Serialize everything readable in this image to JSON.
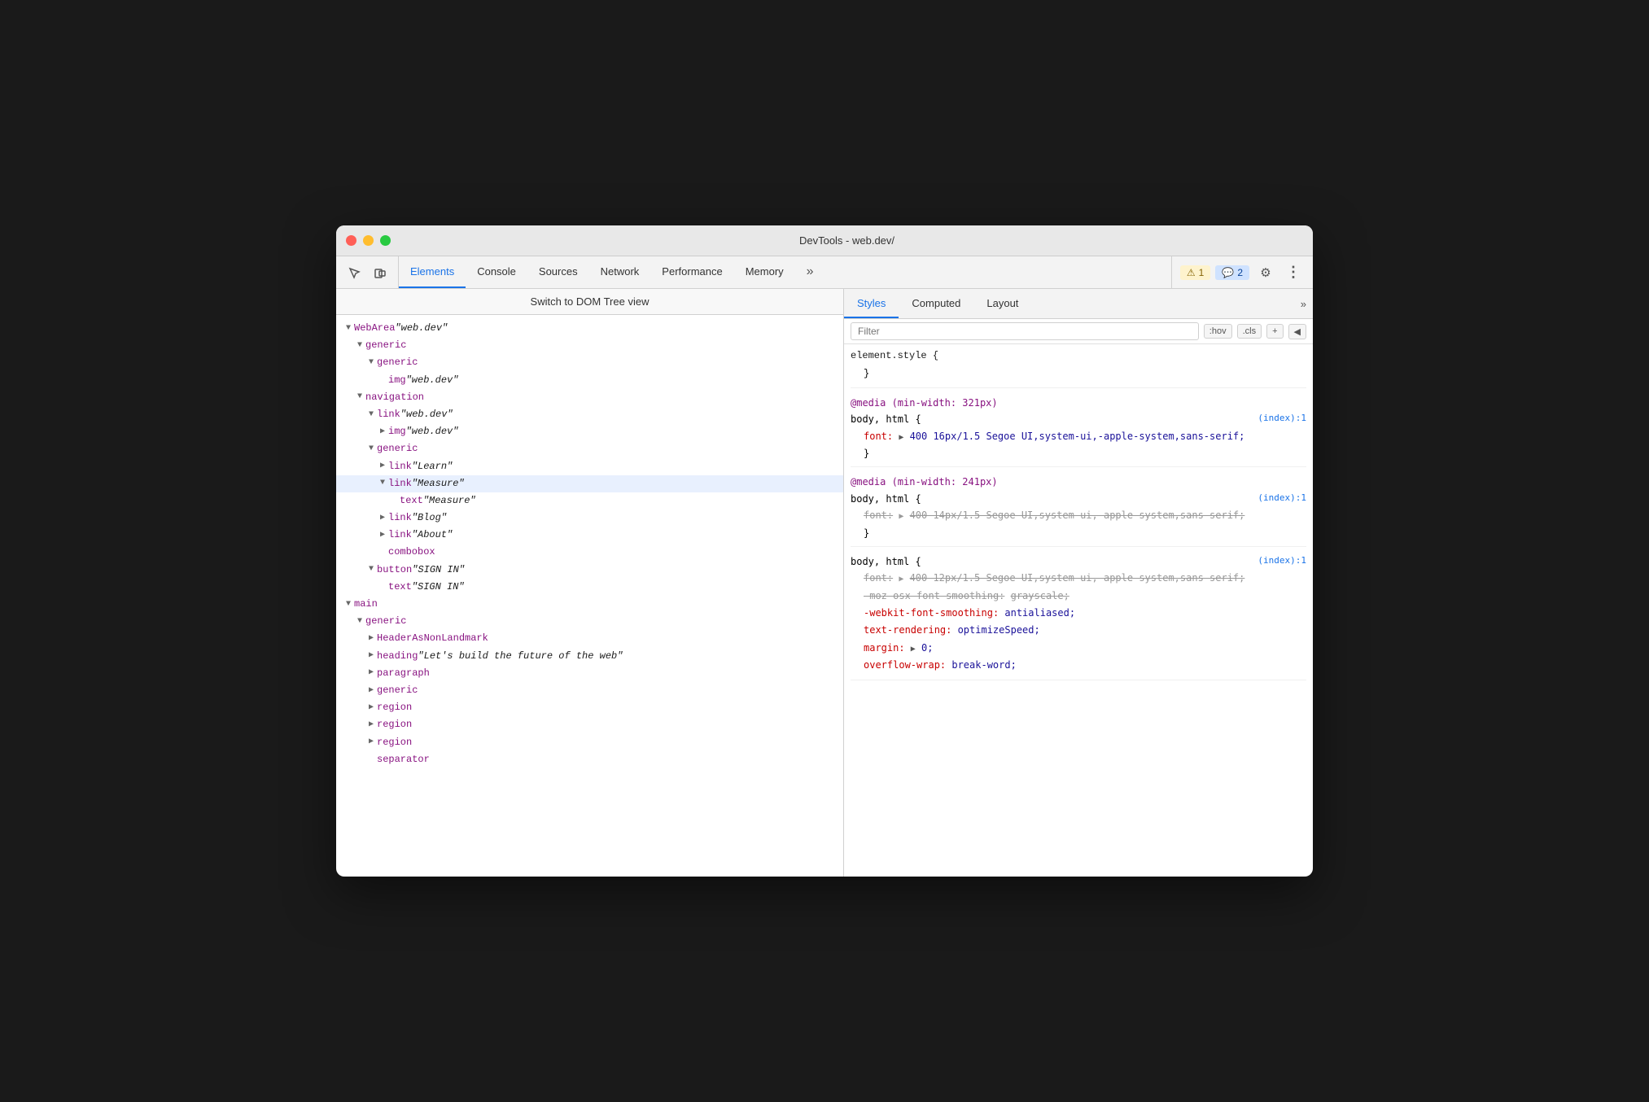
{
  "window": {
    "title": "DevTools - web.dev/"
  },
  "titlebar": {
    "close_label": "",
    "min_label": "",
    "max_label": ""
  },
  "toolbar": {
    "tabs": [
      {
        "id": "elements",
        "label": "Elements",
        "active": true
      },
      {
        "id": "console",
        "label": "Console",
        "active": false
      },
      {
        "id": "sources",
        "label": "Sources",
        "active": false
      },
      {
        "id": "network",
        "label": "Network",
        "active": false
      },
      {
        "id": "performance",
        "label": "Performance",
        "active": false
      },
      {
        "id": "memory",
        "label": "Memory",
        "active": false
      }
    ],
    "more_tabs_label": "»",
    "warning_badge": "⚠ 1",
    "info_badge": "💬 2",
    "settings_icon": "⚙",
    "more_options_icon": "⋮"
  },
  "dom_panel": {
    "breadcrumb": "Switch to DOM Tree view",
    "tree": [
      {
        "id": 1,
        "indent": 0,
        "arrow": "▼",
        "content": "WebArea ",
        "italic": "web.dev",
        "quotes": true
      },
      {
        "id": 2,
        "indent": 1,
        "arrow": "▼",
        "content": "generic"
      },
      {
        "id": 3,
        "indent": 2,
        "arrow": "▼",
        "content": "generic"
      },
      {
        "id": 4,
        "indent": 3,
        "arrow": "",
        "content": "img ",
        "italic": "web.dev",
        "quotes": true
      },
      {
        "id": 5,
        "indent": 1,
        "arrow": "▼",
        "content": "navigation"
      },
      {
        "id": 6,
        "indent": 2,
        "arrow": "▼",
        "content": "link ",
        "italic": "web.dev",
        "quotes": true
      },
      {
        "id": 7,
        "indent": 3,
        "arrow": "▶",
        "content": "img ",
        "italic": "web.dev",
        "quotes": true
      },
      {
        "id": 8,
        "indent": 2,
        "arrow": "▼",
        "content": "generic"
      },
      {
        "id": 9,
        "indent": 3,
        "arrow": "▶",
        "content": "link ",
        "italic": "Learn",
        "quotes": true
      },
      {
        "id": 10,
        "indent": 3,
        "arrow": "▼",
        "content": "link ",
        "italic": "Measure",
        "quotes": true,
        "selected": true
      },
      {
        "id": 11,
        "indent": 4,
        "arrow": "",
        "content": "text ",
        "italic": "Measure",
        "quotes": true
      },
      {
        "id": 12,
        "indent": 3,
        "arrow": "▶",
        "content": "link ",
        "italic": "Blog",
        "quotes": true
      },
      {
        "id": 13,
        "indent": 3,
        "arrow": "▶",
        "content": "link ",
        "italic": "About",
        "quotes": true
      },
      {
        "id": 14,
        "indent": 3,
        "arrow": "",
        "content": "combobox"
      },
      {
        "id": 15,
        "indent": 2,
        "arrow": "▼",
        "content": "button ",
        "italic": "SIGN IN",
        "quotes": true
      },
      {
        "id": 16,
        "indent": 3,
        "arrow": "",
        "content": "text ",
        "italic": "SIGN IN",
        "quotes": true
      },
      {
        "id": 17,
        "indent": 0,
        "arrow": "▼",
        "content": "main"
      },
      {
        "id": 18,
        "indent": 1,
        "arrow": "▼",
        "content": "generic"
      },
      {
        "id": 19,
        "indent": 2,
        "arrow": "▶",
        "content": "HeaderAsNonLandmark"
      },
      {
        "id": 20,
        "indent": 2,
        "arrow": "▶",
        "content": "heading ",
        "italic": "Let's build the future of the web",
        "quotes": true
      },
      {
        "id": 21,
        "indent": 2,
        "arrow": "▶",
        "content": "paragraph"
      },
      {
        "id": 22,
        "indent": 2,
        "arrow": "▶",
        "content": "generic"
      },
      {
        "id": 23,
        "indent": 2,
        "arrow": "▶",
        "content": "region"
      },
      {
        "id": 24,
        "indent": 2,
        "arrow": "▶",
        "content": "region"
      },
      {
        "id": 25,
        "indent": 2,
        "arrow": "▶",
        "content": "region"
      },
      {
        "id": 26,
        "indent": 2,
        "arrow": "",
        "content": "separator"
      }
    ]
  },
  "styles_panel": {
    "tabs": [
      {
        "id": "styles",
        "label": "Styles",
        "active": true
      },
      {
        "id": "computed",
        "label": "Computed",
        "active": false
      },
      {
        "id": "layout",
        "label": "Layout",
        "active": false
      }
    ],
    "filter_placeholder": "Filter",
    "hov_btn": ":hov",
    "cls_btn": ".cls",
    "add_btn": "+",
    "toggle_btn": "◀",
    "rules": [
      {
        "id": 1,
        "selector_parts": [
          {
            "text": "element.style {",
            "type": "selector"
          }
        ],
        "source": "",
        "properties": [
          {
            "id": 1,
            "content": "}",
            "type": "close"
          }
        ]
      },
      {
        "id": 2,
        "media": "@media (min-width: 321px)",
        "selector": "body, html {",
        "source": "(index):1",
        "properties": [
          {
            "id": 1,
            "name": "font:",
            "arrow": "▶",
            "value": " 400 16px/1.5 Segoe UI,system-ui,-apple-system,sans-serif;",
            "strikethrough": false
          }
        ],
        "close": "}"
      },
      {
        "id": 3,
        "media": "@media (min-width: 241px)",
        "selector": "body, html {",
        "source": "(index):1",
        "properties": [
          {
            "id": 1,
            "name": "font:",
            "arrow": "▶",
            "value": " 400 14px/1.5 Segoe UI,system-ui,-apple-system,sans-serif;",
            "strikethrough": true
          }
        ],
        "close": "}"
      },
      {
        "id": 4,
        "selector": "body, html {",
        "source": "(index):1",
        "properties": [
          {
            "id": 1,
            "name": "font:",
            "arrow": "▶",
            "value": " 400 12px/1.5 Segoe UI,system-ui,-apple-system,sans-serif;",
            "strikethrough": true
          },
          {
            "id": 2,
            "name": "-moz-osx-font-smoothing:",
            "value": " grayscale;",
            "strikethrough": true
          },
          {
            "id": 3,
            "name": "-webkit-font-smoothing:",
            "value": " antialiased;",
            "strikethrough": false,
            "name_color": "red"
          },
          {
            "id": 4,
            "name": "text-rendering:",
            "value": " optimizeSpeed;",
            "strikethrough": false,
            "name_color": "red"
          },
          {
            "id": 5,
            "name": "margin:",
            "arrow": "▶",
            "value": " 0;",
            "strikethrough": false,
            "name_color": "red"
          },
          {
            "id": 6,
            "name": "overflow-wrap:",
            "value": " break-word;",
            "strikethrough": false,
            "name_color": "red",
            "partial": true
          }
        ],
        "close": ""
      }
    ]
  }
}
